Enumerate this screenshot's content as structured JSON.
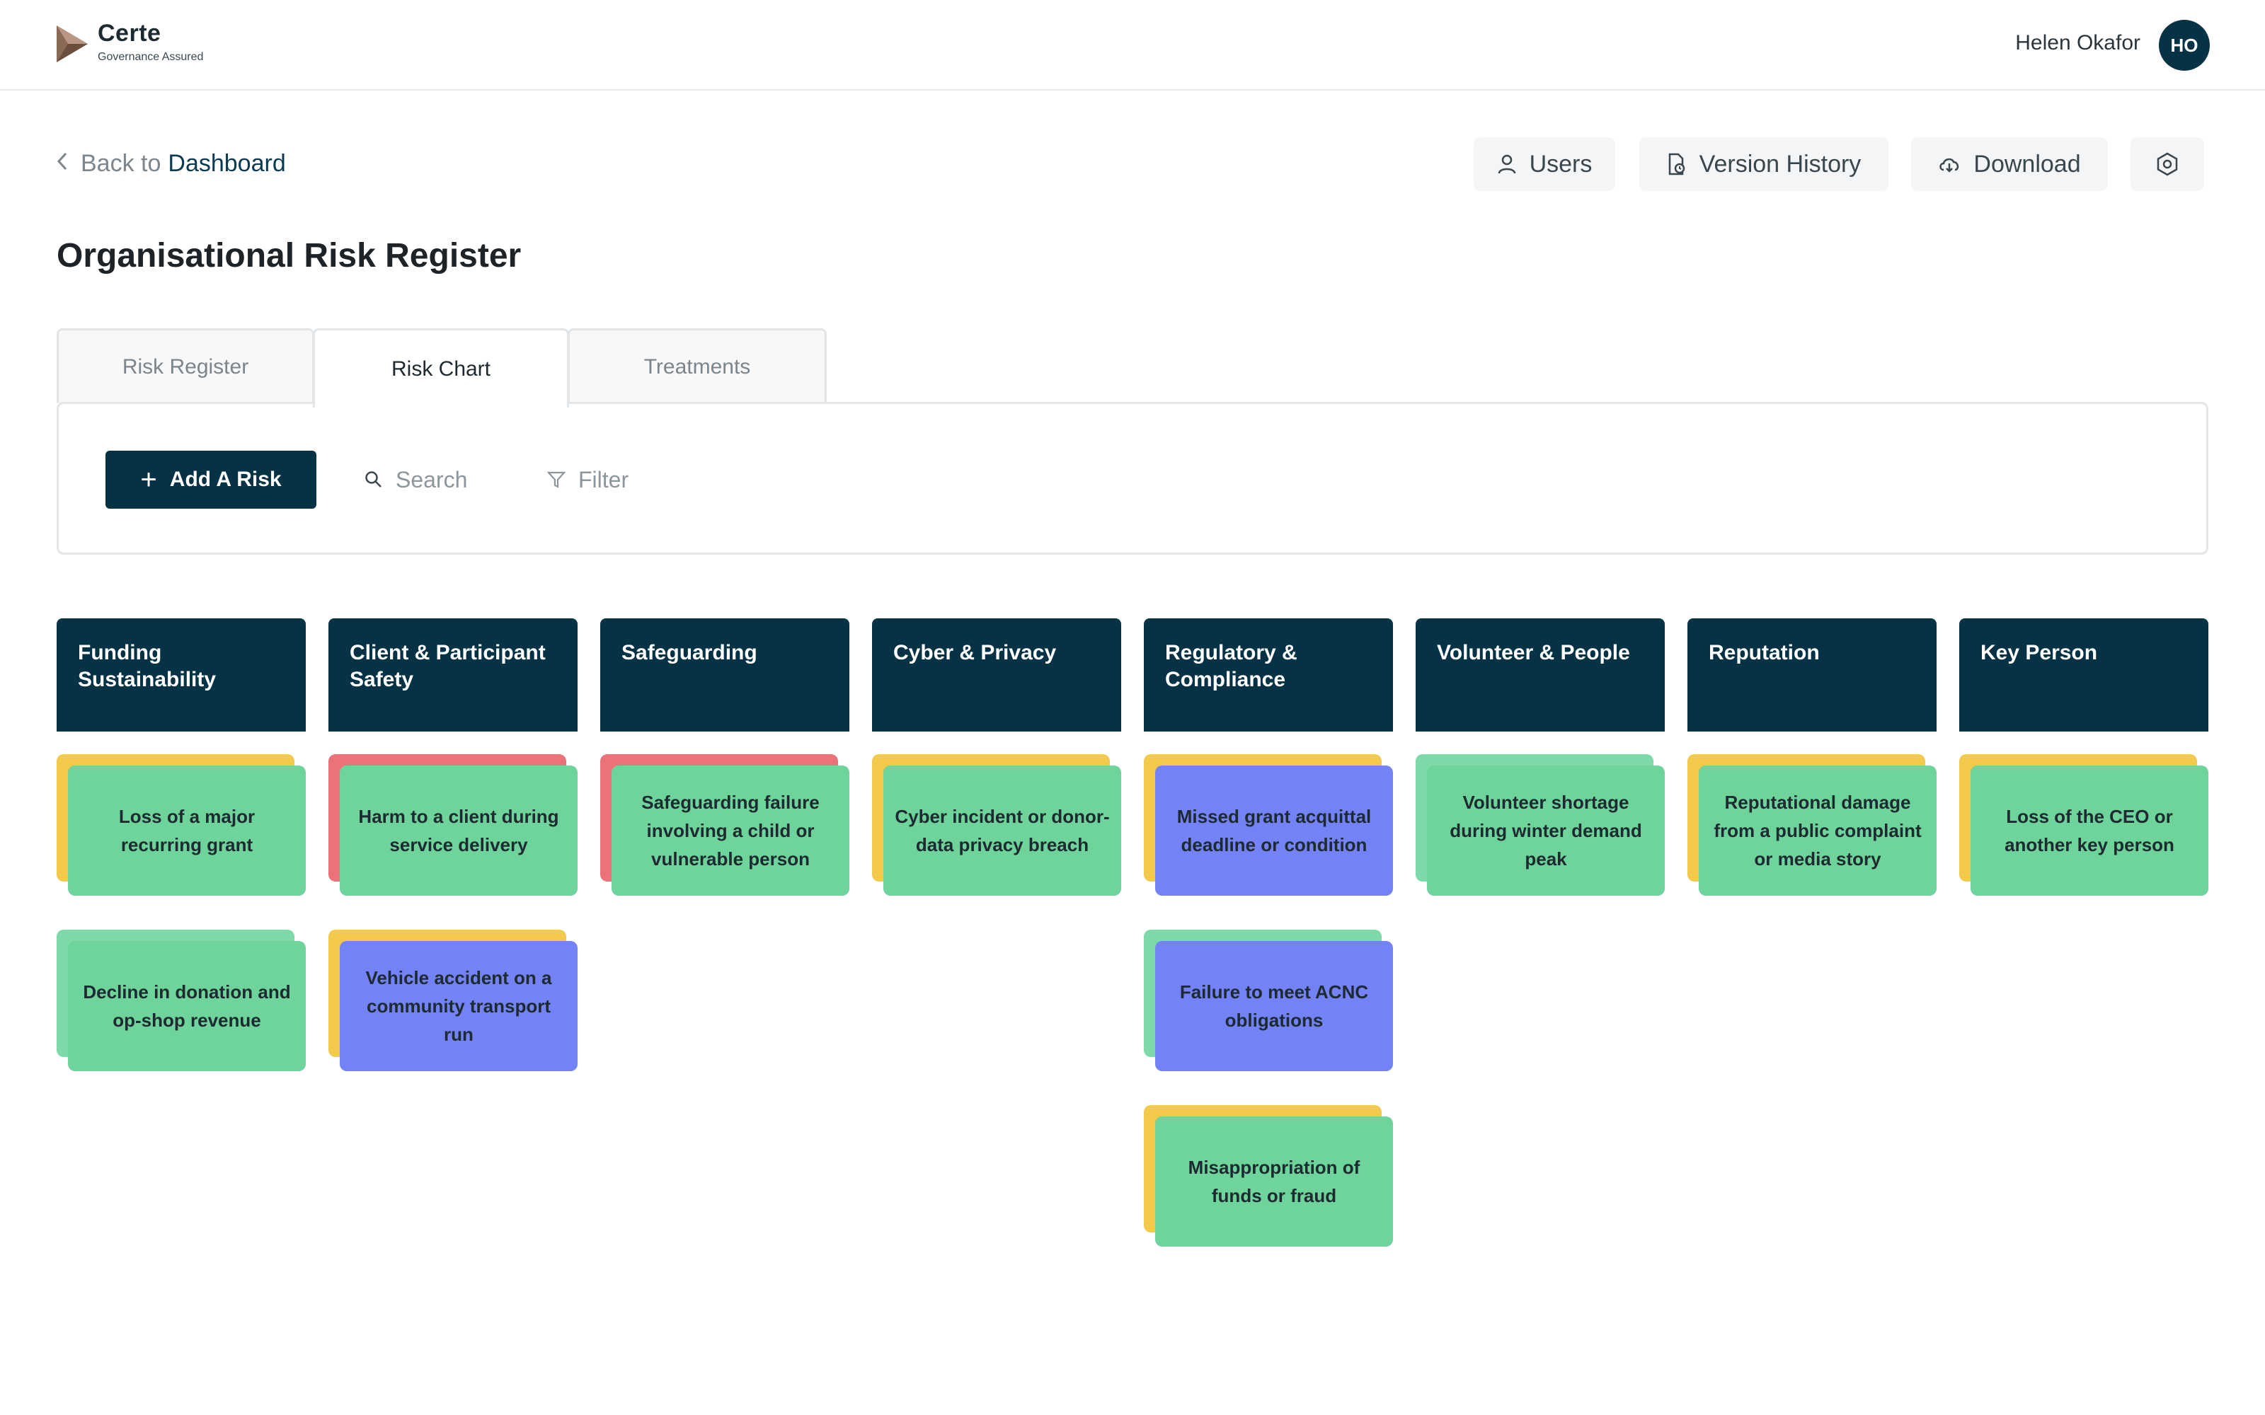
{
  "brand": {
    "name": "Certe",
    "tagline": "Governance Assured"
  },
  "user": {
    "name": "Helen Okafor",
    "initials": "HO"
  },
  "nav": {
    "back_prefix": "Back to",
    "back_target": "Dashboard"
  },
  "toolbar": {
    "users": "Users",
    "version_history": "Version History",
    "download": "Download"
  },
  "page": {
    "title": "Organisational Risk Register"
  },
  "tabs": [
    "Risk Register",
    "Risk Chart",
    "Treatments"
  ],
  "active_tab": "Risk Chart",
  "actions": {
    "add_risk": "Add A Risk",
    "search_placeholder": "Search",
    "filter": "Filter"
  },
  "colors": {
    "navy": "#053245",
    "green": "#6fd49c",
    "blue": "#7383f5",
    "yellow": "#f3c94b",
    "red": "#ea7278",
    "light_green": "#7ed9a8"
  },
  "columns": [
    {
      "title": "Funding Sustainability",
      "cards": [
        {
          "label": "Loss of a major recurring grant",
          "front": "green",
          "back": "yellow"
        },
        {
          "label": "Decline in donation and op-shop revenue",
          "front": "green",
          "back": "light_green"
        }
      ]
    },
    {
      "title": "Client & Participant Safety",
      "cards": [
        {
          "label": "Harm to a client during service delivery",
          "front": "green",
          "back": "red"
        },
        {
          "label": "Vehicle accident on a community transport run",
          "front": "blue",
          "back": "yellow"
        }
      ]
    },
    {
      "title": "Safeguarding",
      "cards": [
        {
          "label": "Safeguarding failure involving a child or vulnerable person",
          "front": "green",
          "back": "red"
        }
      ]
    },
    {
      "title": "Cyber & Privacy",
      "cards": [
        {
          "label": "Cyber incident or donor-data privacy breach",
          "front": "green",
          "back": "yellow"
        }
      ]
    },
    {
      "title": "Regulatory & Compliance",
      "cards": [
        {
          "label": "Missed grant acquittal deadline or condition",
          "front": "blue",
          "back": "yellow"
        },
        {
          "label": "Failure to meet ACNC obligations",
          "front": "blue",
          "back": "light_green"
        },
        {
          "label": "Misappropriation of funds or fraud",
          "front": "green",
          "back": "yellow"
        }
      ]
    },
    {
      "title": "Volunteer & People",
      "cards": [
        {
          "label": "Volunteer shortage during winter demand peak",
          "front": "green",
          "back": "light_green"
        }
      ]
    },
    {
      "title": "Reputation",
      "cards": [
        {
          "label": "Reputational damage from a public complaint or media story",
          "front": "green",
          "back": "yellow"
        }
      ]
    },
    {
      "title": "Key Person",
      "cards": [
        {
          "label": "Loss of the CEO or another key person",
          "front": "green",
          "back": "yellow"
        }
      ]
    }
  ]
}
